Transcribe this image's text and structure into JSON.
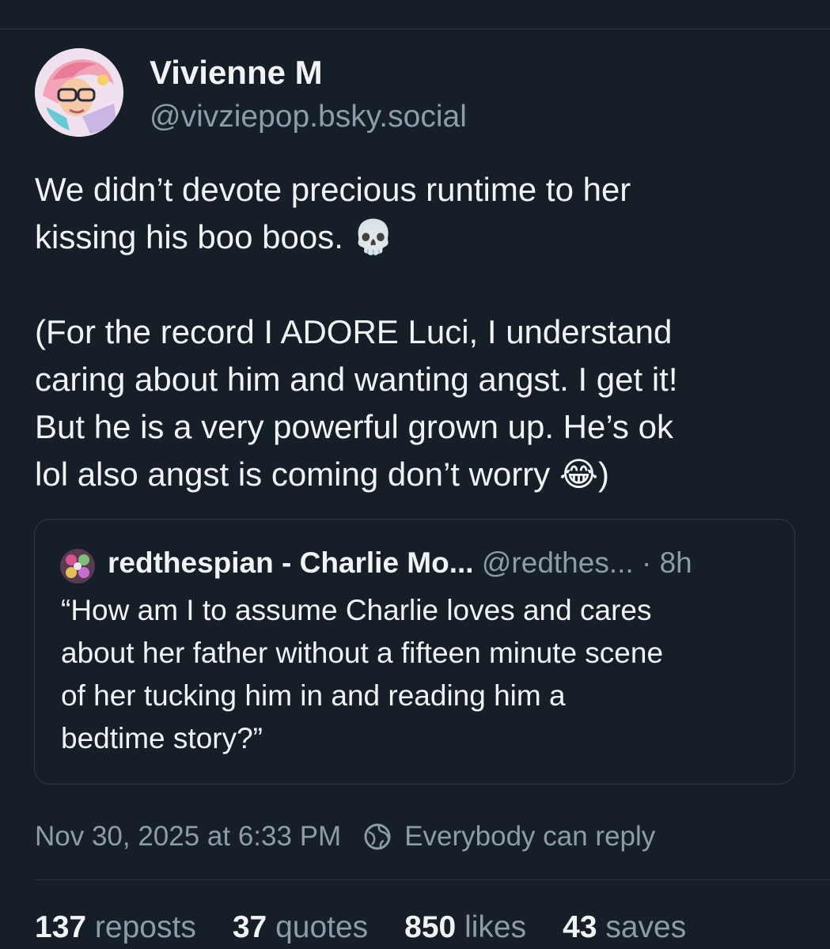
{
  "colors": {
    "background": "#161e27",
    "text_primary": "#f1f3f5",
    "text_secondary": "#8d9bab",
    "border": "#2e3944"
  },
  "author": {
    "display_name": "Vivienne M",
    "handle": "@vivziepop.bsky.social",
    "avatar_icon": "avatar-illustration"
  },
  "post": {
    "lines": [
      "We didn’t devote precious runtime to her",
      "kissing his boo boos. ",
      "(For the record I ADORE Luci, I understand",
      "caring about him and wanting angst. I get it!",
      "But he is a very powerful grown up. He’s ok",
      "lol also angst is coming don’t worry ",
      ")"
    ],
    "emoji_skull": "💀",
    "emoji_laugh": "😂"
  },
  "quote": {
    "name": "redthespian - Charlie Mo...",
    "handle": "@redthes...",
    "separator": "·",
    "time": "8h",
    "lines": [
      "“How am I to assume Charlie loves and cares",
      "about her father without a fifteen minute scene",
      "of her tucking him in and reading him a",
      "bedtime story?”"
    ]
  },
  "meta": {
    "timestamp": "Nov 30, 2025 at 6:33 PM",
    "reply_setting": "Everybody can reply",
    "reply_icon": "globe-icon"
  },
  "stats": [
    {
      "count": "137",
      "label": "reposts"
    },
    {
      "count": "37",
      "label": "quotes"
    },
    {
      "count": "850",
      "label": "likes"
    },
    {
      "count": "43",
      "label": "saves"
    }
  ]
}
